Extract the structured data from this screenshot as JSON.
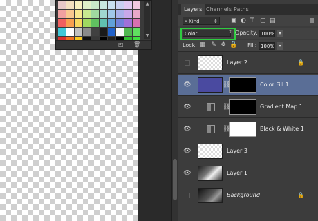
{
  "swatches": {
    "colors": [
      "#e8c8c8",
      "#f4e0c0",
      "#f8f0c0",
      "#e0f0c8",
      "#c8e8c8",
      "#c8e8e0",
      "#c8e0f0",
      "#c8d0f0",
      "#e0c8f0",
      "#f0c8e0",
      "#f0a0a0",
      "#f8c890",
      "#f8e890",
      "#c8e890",
      "#a0d8a0",
      "#a0d8d0",
      "#a0c8e8",
      "#a8b0e8",
      "#c8a8e8",
      "#e8a8c8",
      "#f06060",
      "#f8a050",
      "#f8d860",
      "#a0d860",
      "#60c060",
      "#60c0b0",
      "#60a0d8",
      "#7080d8",
      "#a070d8",
      "#d870b0",
      "#40c8d8",
      "#ffffff",
      "#c0c0c0",
      "#8a8a8a",
      "#404040",
      "#1a1a1a",
      "#2060c8",
      "#f8f8f8",
      "#50b850",
      "#60e060",
      "#d83030",
      "#f07020",
      "#f8c820",
      "#101010",
      "#383838",
      "#000000",
      "#1f1f1f",
      "#000000",
      "#30c030",
      "#40e040"
    ]
  },
  "panel": {
    "tabs": [
      "Layers",
      "Channels",
      "Paths"
    ],
    "filter": {
      "kind_label": "Kind",
      "icons": [
        "image-filter-icon",
        "adjustment-filter-icon",
        "type-filter-icon",
        "shape-filter-icon",
        "smart-object-filter-icon"
      ]
    },
    "blend_mode": "Color",
    "opacity_label": "Opacity:",
    "opacity_value": "100%",
    "lock_label": "Lock:",
    "fill_label": "Fill:",
    "fill_value": "100%"
  },
  "layers": [
    {
      "name": "Layer 2",
      "visible": false,
      "thumb": "checker",
      "locked": true
    },
    {
      "name": "Color Fill 1",
      "visible": true,
      "selected": true,
      "thumb": "#4a4aa0",
      "mask": "#000000"
    },
    {
      "name": "Gradient Map 1",
      "visible": true,
      "adjustment": true,
      "mask": "#000000"
    },
    {
      "name": "Black & White 1",
      "visible": true,
      "adjustment": true,
      "mask": "#ffffff"
    },
    {
      "name": "Layer 3",
      "visible": true,
      "thumb": "checker"
    },
    {
      "name": "Layer 1",
      "visible": true,
      "thumb": "photo"
    },
    {
      "name": "Background",
      "visible": false,
      "thumb": "photo-dark",
      "locked": true,
      "italic": true
    }
  ]
}
